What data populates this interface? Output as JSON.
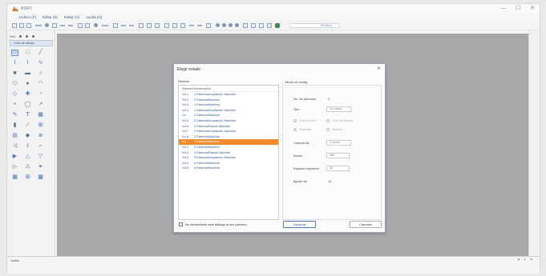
{
  "window": {
    "title": "ASKO",
    "controls": [
      "—",
      "☐",
      "✕"
    ]
  },
  "menu": [
    "Archivo (F)",
    "Editar (E)",
    "Editar (V)",
    "Ayuda (H)"
  ],
  "toolbar": {
    "zoom_value": "ELUALL"
  },
  "left_panel": {
    "title": "Vch",
    "tab_label": "Lista de dibujo",
    "palette_icons": [
      "select-icon",
      "rectangle-icon",
      "line-icon",
      "text-icon",
      "polyline-icon",
      "curve-icon",
      "square-fill-icon",
      "filled-rect-icon",
      "circle-icon",
      "ellipse-icon",
      "circle-fill-icon",
      "arc-icon",
      "diamond-icon",
      "cross-icon",
      "sector-icon",
      "dot-icon",
      "circle-outline-icon",
      "arrow-icon",
      "pen-icon",
      "text-t-icon",
      "table-icon",
      "bar-icon",
      "slash-icon",
      "grid-icon",
      "gradient-icon",
      "diamond-fill-icon",
      "stack-icon",
      "shuffle-icon",
      "lasso-icon",
      "bracket-icon",
      "play-icon",
      "triangle-icon",
      "triangle-outline-icon",
      "play-outline-icon",
      "warning-icon",
      "funnel-icon",
      "grid-small-icon",
      "grid-large-icon",
      "cell-icon"
    ]
  },
  "bottom_panel": {
    "title": "Salida"
  },
  "dialog": {
    "title": "Elegir estado",
    "left_label": "Nombre",
    "right_label": "Modo de config.",
    "list": {
      "columns": [
        "Nombre",
        "Información"
      ],
      "rows": [
        {
          "n": "Vd-1",
          "info": "1:Sistema\\Ampliación Machine"
        },
        {
          "n": "Vd-2",
          "info": "1:Sistema\\Machine"
        },
        {
          "n": "Vd-3",
          "info": "1:Sistema\\Machine"
        },
        {
          "n": "Vd-4",
          "info": "1:Sistema\\Ampliación Machine"
        },
        {
          "n": "Vd",
          "info": "1:Sistema\\Machine"
        },
        {
          "n": "Vd-5",
          "info": "2:Sistema\\Ampliación Machine"
        },
        {
          "n": "Vd-6",
          "info": "2:Sistema\\Estado Machine"
        },
        {
          "n": "Vd-7",
          "info": "2:Sistema\\Ampliación Machine"
        },
        {
          "n": "Vd-8",
          "info": "2:Sistema\\Machine"
        },
        {
          "n": "Vd",
          "info": "3:Sistema\\Machine"
        },
        {
          "n": "Vd-1",
          "info": "3:Sistema\\Machine"
        },
        {
          "n": "Vd-2",
          "info": "3:Sistema\\Estado Machine"
        },
        {
          "n": "Vd-3",
          "info": "3:Sistema\\Ampliación Machine"
        },
        {
          "n": "Vd-4",
          "info": "4:Sistema\\Machine"
        },
        {
          "n": "Vd-5",
          "info": "4:Sistema\\Machine"
        }
      ],
      "selected_index": 9
    },
    "config": {
      "num_label": "No. de persona:",
      "num_value": "0",
      "tipo_label": "Tipo",
      "tipo_value": "Sin datos",
      "radio1": "Ciclo de otro",
      "radio2": "Ciclo de fabrica",
      "radio3": "Opcional",
      "radio4": "Mostrar",
      "cadena_label": "Cadena de",
      "cadena_value": "Cuando",
      "ancho_label": "Ancho",
      "ancho_value": "200",
      "espacio_label": "Espacio Izquierdo",
      "espacio_value": "10",
      "ajuste_label": "Ajuste de",
      "ajuste_value": "10"
    },
    "checkbox_label": "No denunciarte este diálogo la vez próximo",
    "ok_label": "Aquarda",
    "cancel_label": "Cancelar"
  }
}
